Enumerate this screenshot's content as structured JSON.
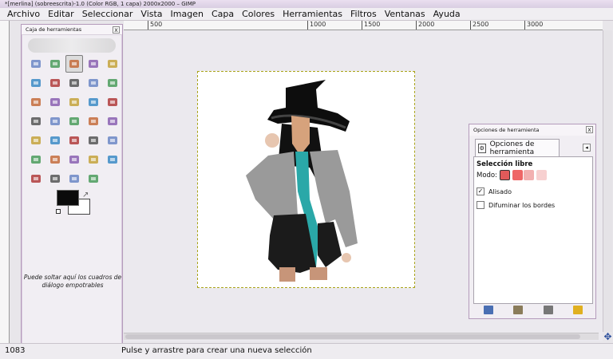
{
  "window": {
    "title": "*[merlina] (sobreescrita)-1.0 (Color RGB, 1 capa) 2000x2000 – GIMP"
  },
  "menubar": {
    "items": [
      {
        "label": "Archivo"
      },
      {
        "label": "Editar"
      },
      {
        "label": "Seleccionar"
      },
      {
        "label": "Vista"
      },
      {
        "label": "Imagen"
      },
      {
        "label": "Capa"
      },
      {
        "label": "Colores"
      },
      {
        "label": "Herramientas"
      },
      {
        "label": "Filtros"
      },
      {
        "label": "Ventanas"
      },
      {
        "label": "Ayuda"
      }
    ]
  },
  "ruler": {
    "top_labels": [
      "500",
      "1000",
      "1500",
      "2000",
      "2500",
      "3000"
    ]
  },
  "toolbox": {
    "title": "Caja de herramientas",
    "close_label": "x",
    "dock_hint": "Puede soltar aquí los cuadros de diálogo empotrables",
    "colors": {
      "foreground": "#0b0b0b",
      "background": "#ffffff"
    },
    "tools": [
      {
        "icon": "rect-select-icon"
      },
      {
        "icon": "ellipse-select-icon"
      },
      {
        "icon": "free-select-icon",
        "active": true
      },
      {
        "icon": "fuzzy-select-icon"
      },
      {
        "icon": "by-color-select-icon"
      },
      {
        "icon": "scissors-select-icon"
      },
      {
        "icon": "foreground-select-icon"
      },
      {
        "icon": "paths-icon"
      },
      {
        "icon": "color-picker-icon"
      },
      {
        "icon": "zoom-icon"
      },
      {
        "icon": "measure-icon"
      },
      {
        "icon": "move-icon"
      },
      {
        "icon": "align-icon"
      },
      {
        "icon": "crop-icon"
      },
      {
        "icon": "rotate-icon"
      },
      {
        "icon": "scale-icon"
      },
      {
        "icon": "shear-icon"
      },
      {
        "icon": "perspective-icon"
      },
      {
        "icon": "flip-icon"
      },
      {
        "icon": "cage-transform-icon"
      },
      {
        "icon": "text-icon"
      },
      {
        "icon": "bucket-fill-icon"
      },
      {
        "icon": "blend-icon"
      },
      {
        "icon": "pencil-icon"
      },
      {
        "icon": "paintbrush-icon"
      },
      {
        "icon": "eraser-icon"
      },
      {
        "icon": "airbrush-icon"
      },
      {
        "icon": "ink-icon"
      },
      {
        "icon": "clone-icon"
      },
      {
        "icon": "heal-icon"
      },
      {
        "icon": "perspective-clone-icon"
      },
      {
        "icon": "blur-sharpen-icon"
      },
      {
        "icon": "smudge-icon"
      },
      {
        "icon": "dodge-burn-icon"
      }
    ]
  },
  "tool_options": {
    "window_title": "Opciones de herramienta",
    "tab_label": "Opciones de herramienta",
    "tool_name": "Selección libre",
    "mode_label": "Modo:",
    "antialias_label": "Alisado",
    "antialias_checked": true,
    "feather_label": "Difuminar los bordes",
    "feather_checked": false,
    "footer_icons": [
      "save-options-icon",
      "restore-options-icon",
      "delete-options-icon",
      "reset-options-icon"
    ]
  },
  "status": {
    "coords": "1083",
    "message": "Pulse y arrastre para crear una nueva selección"
  }
}
